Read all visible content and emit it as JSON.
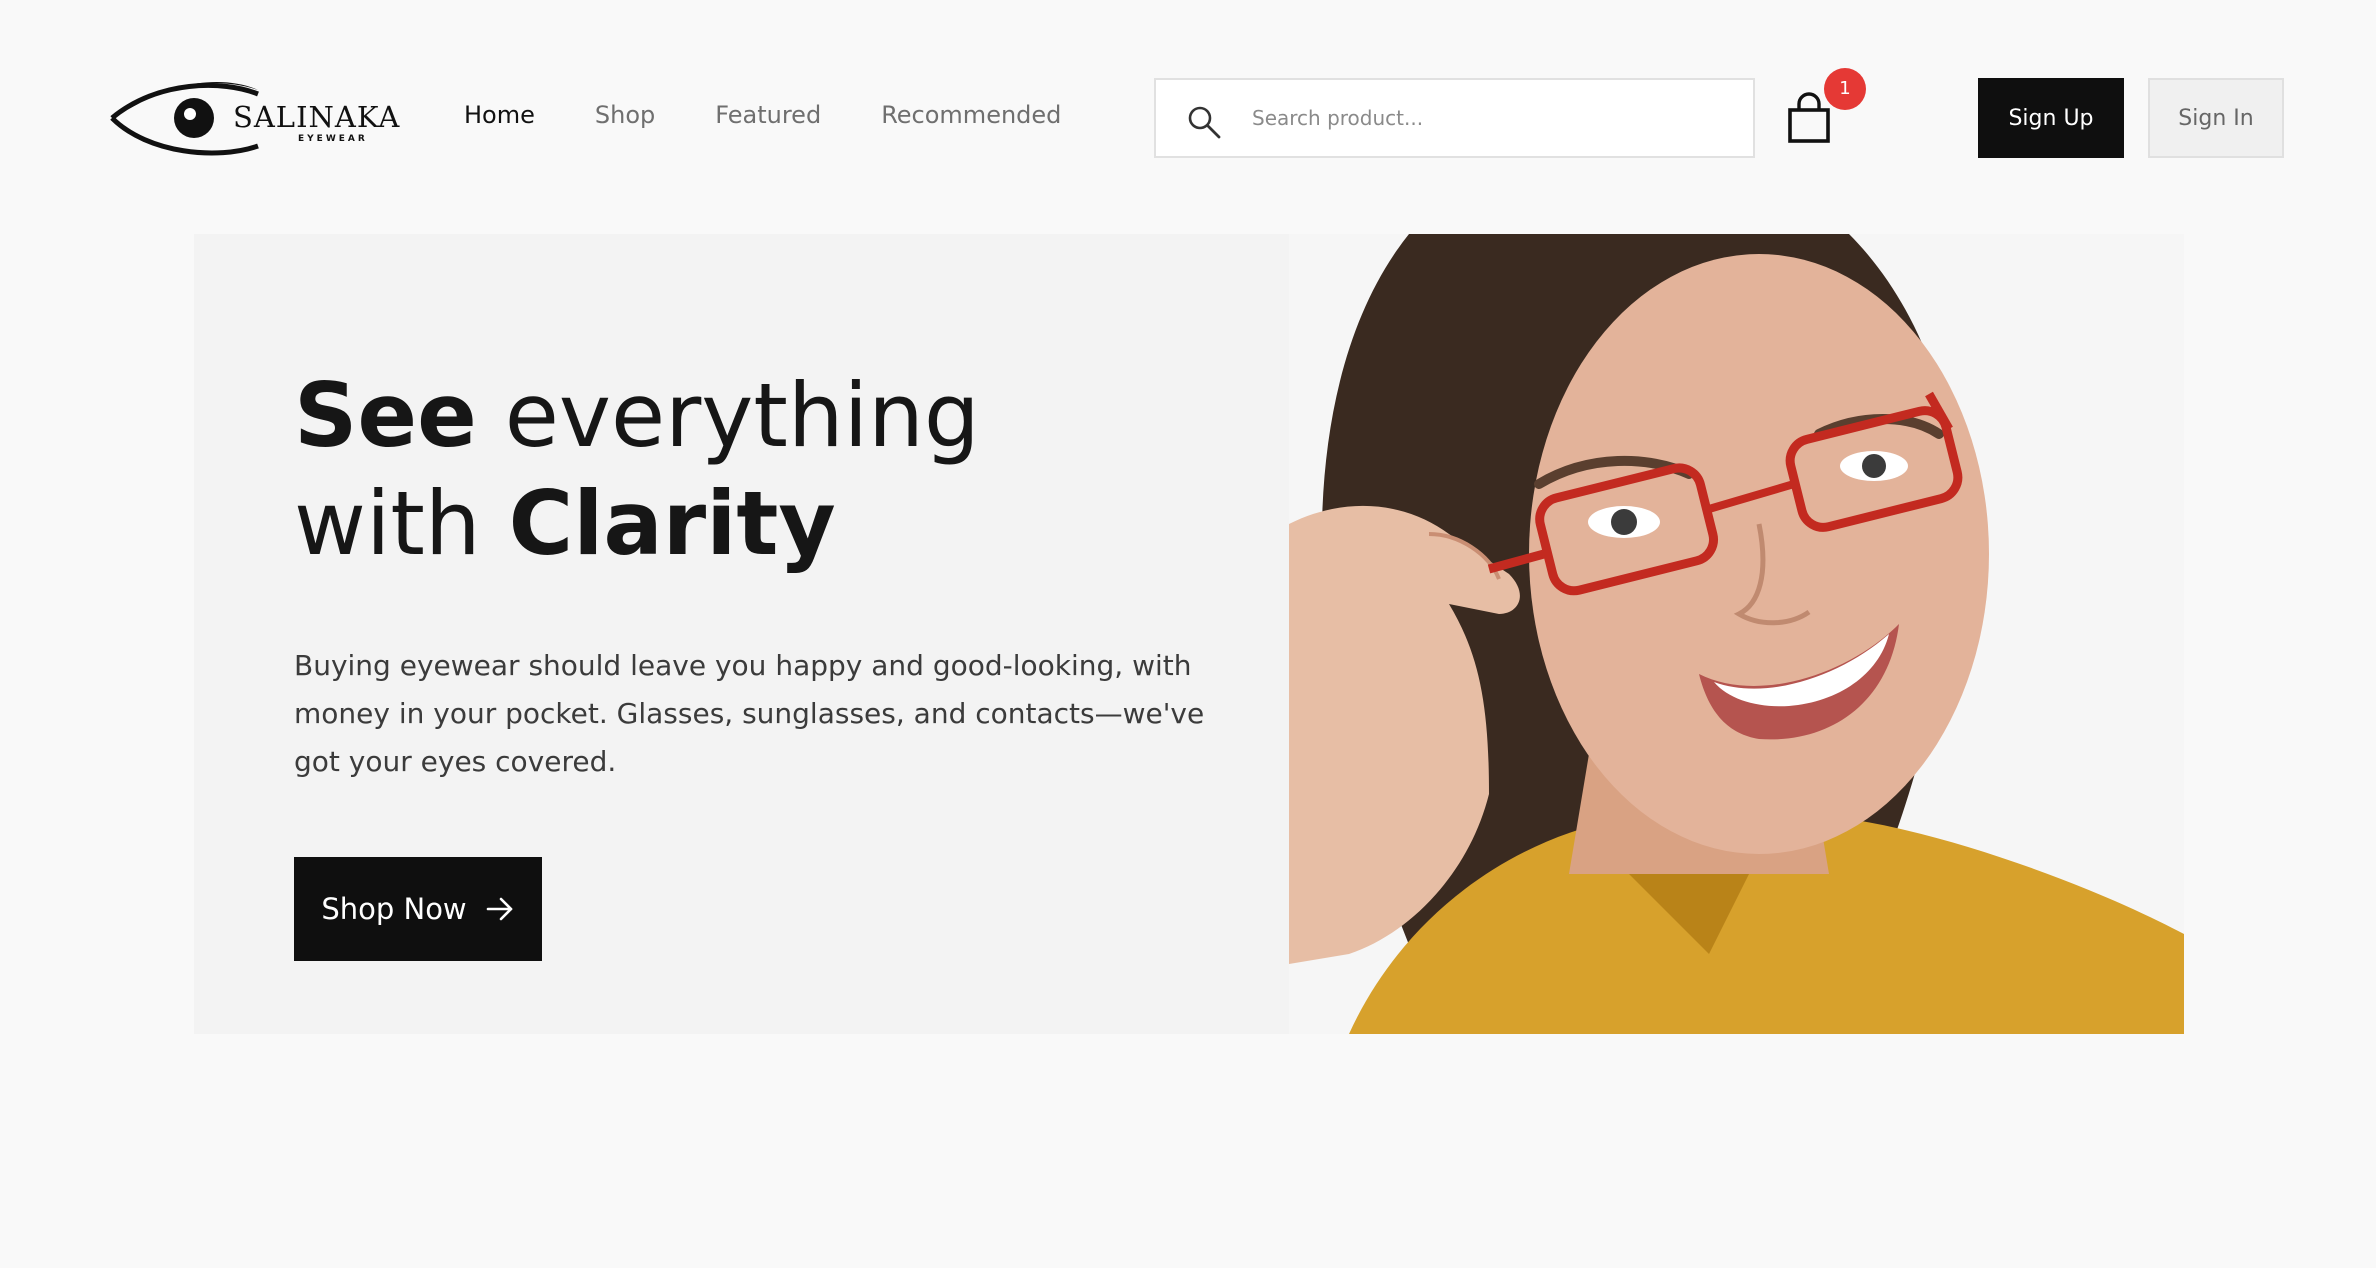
{
  "brand": {
    "name": "SALINAKA",
    "tagline": "EYEWEAR"
  },
  "nav": {
    "links": [
      {
        "label": "Home",
        "active": true
      },
      {
        "label": "Shop",
        "active": false
      },
      {
        "label": "Featured",
        "active": false
      },
      {
        "label": "Recommended",
        "active": false
      }
    ]
  },
  "search": {
    "placeholder": "Search product...",
    "value": "",
    "icon": "search-icon"
  },
  "cart": {
    "icon": "shopping-bag-icon",
    "count": "1"
  },
  "auth": {
    "signup_label": "Sign Up",
    "signin_label": "Sign In"
  },
  "hero": {
    "title_line1_bold": "See",
    "title_line1_rest": " everything",
    "title_line2_pre": "with ",
    "title_line2_bold": "Clarity",
    "text": "Buying eyewear should leave you happy and good-looking, with money in your pocket. Glasses, sunglasses, and contacts—we've got your eyes covered.",
    "cta_label": "Shop Now",
    "cta_icon": "arrow-right-icon",
    "image_subject": "woman-with-red-glasses-photo"
  },
  "colors": {
    "background": "#f9f9f9",
    "hero_background": "#f3f3f3",
    "primary_button": "#0f0f0f",
    "badge": "#e53935"
  }
}
